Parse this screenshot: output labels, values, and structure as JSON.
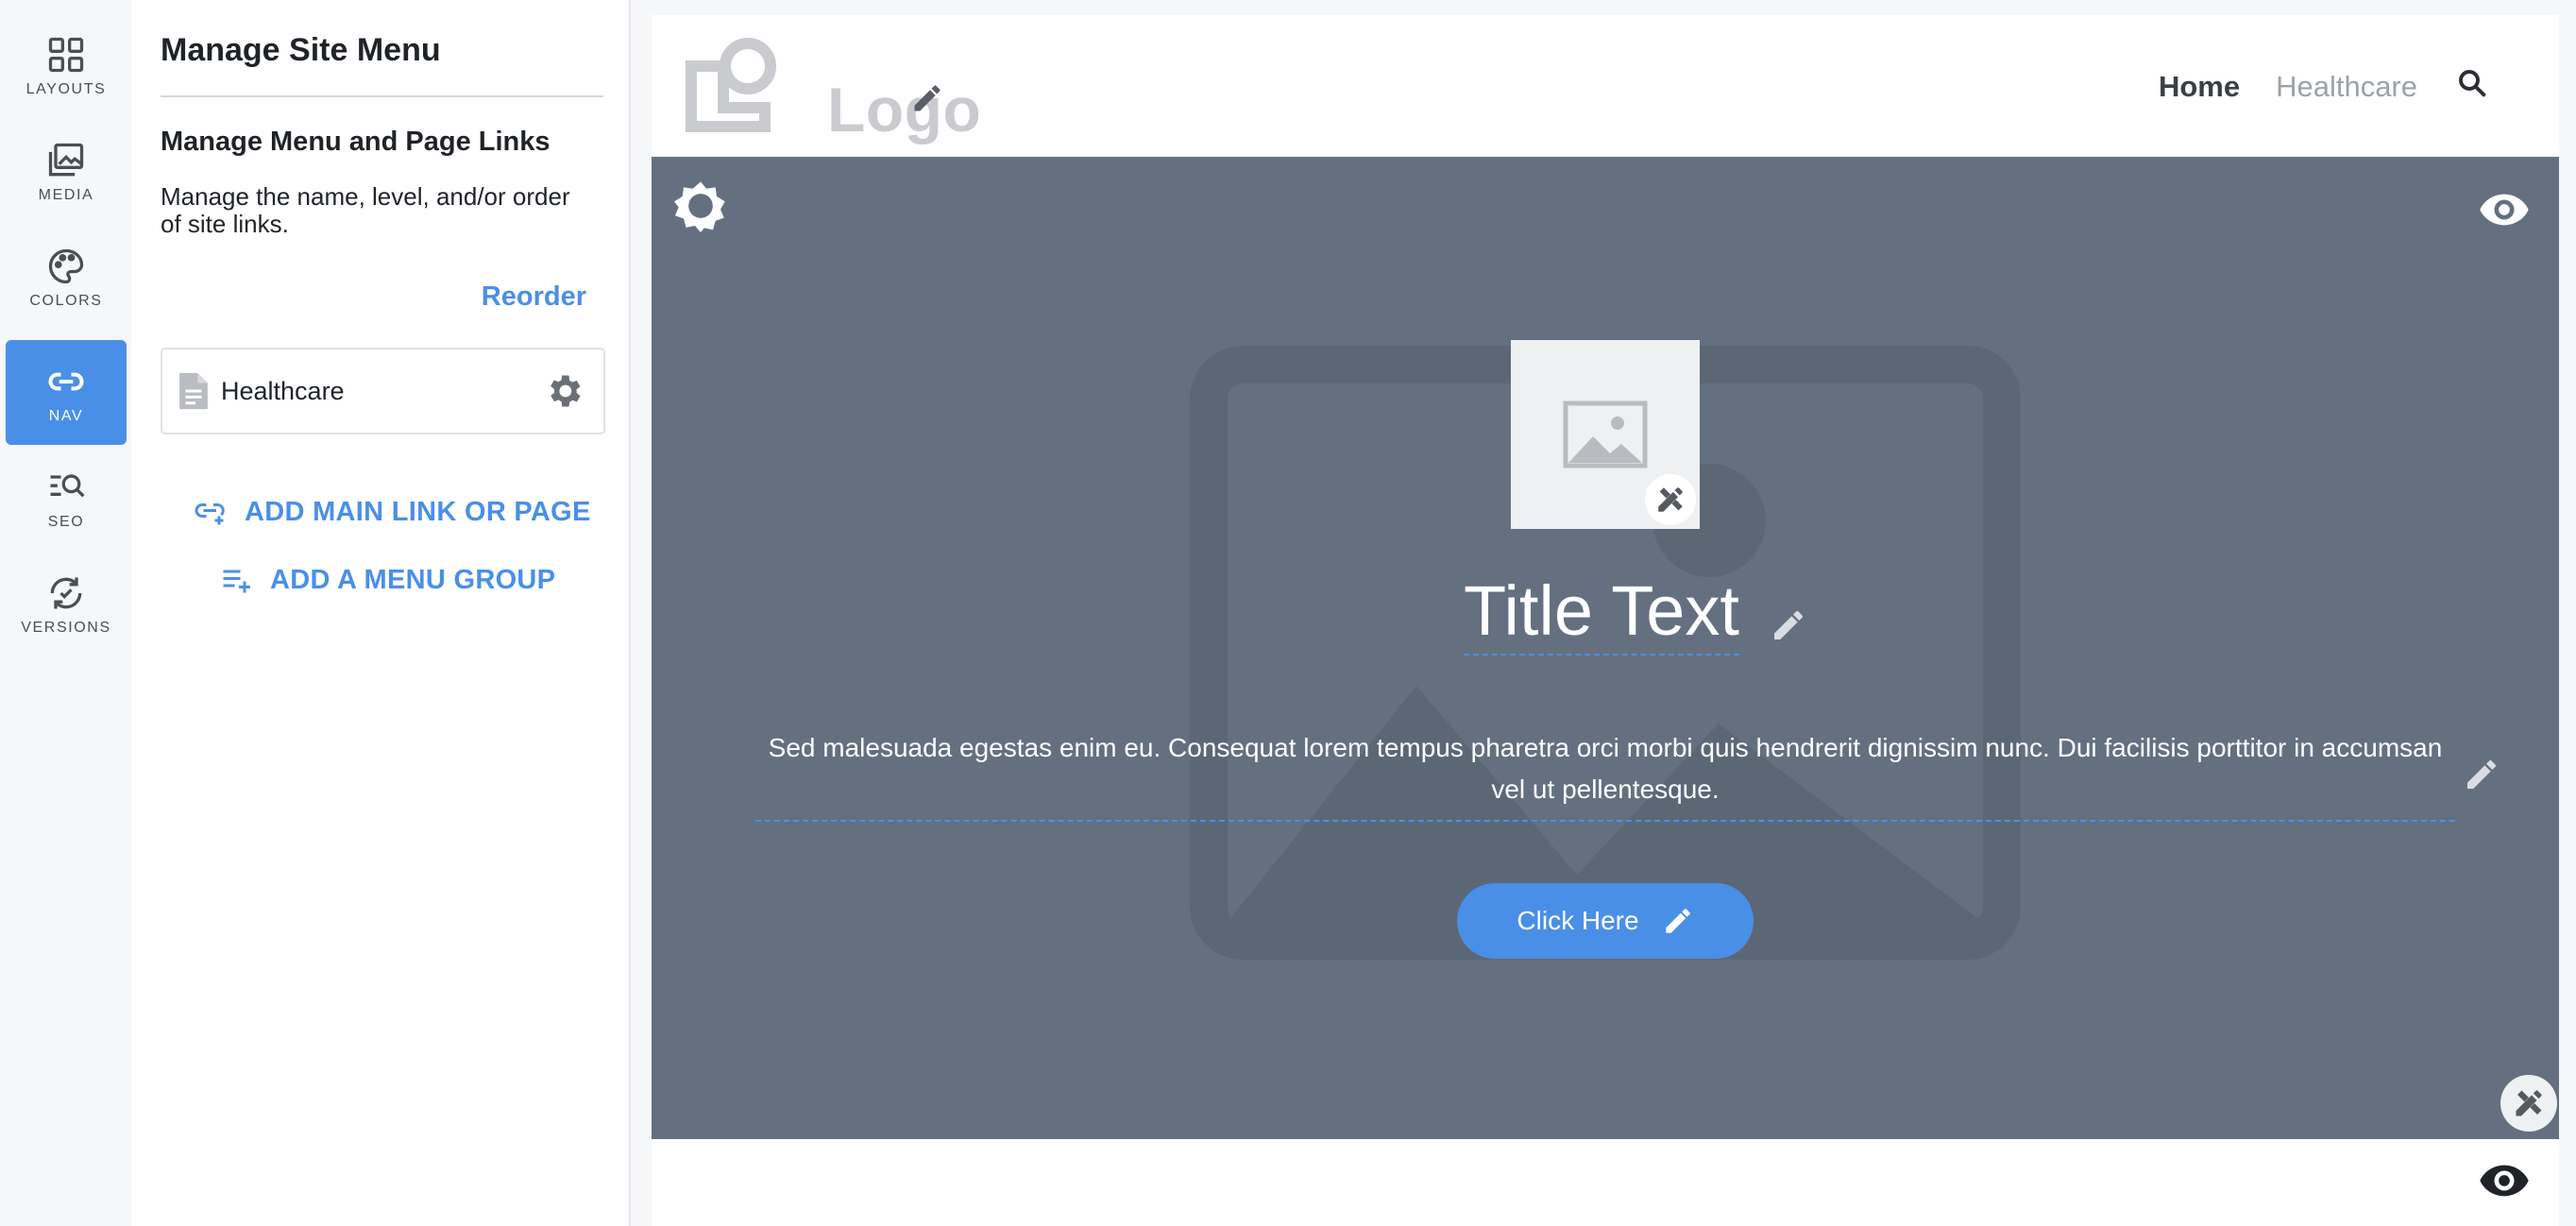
{
  "rail": {
    "items": [
      {
        "label": "LAYOUTS",
        "icon": "layouts-icon"
      },
      {
        "label": "MEDIA",
        "icon": "media-icon"
      },
      {
        "label": "COLORS",
        "icon": "palette-icon"
      },
      {
        "label": "NAV",
        "icon": "link-icon",
        "active": true
      },
      {
        "label": "SEO",
        "icon": "seo-search-icon"
      },
      {
        "label": "VERSIONS",
        "icon": "versions-icon"
      }
    ]
  },
  "panel": {
    "title": "Manage Site Menu",
    "subtitle": "Manage Menu and Page Links",
    "description": "Manage the name, level, and/or order of site links.",
    "reorder_label": "Reorder",
    "links": [
      {
        "name": "Healthcare"
      }
    ],
    "add_main_link_label": "ADD MAIN LINK OR PAGE",
    "add_menu_group_label": "ADD A MENU GROUP"
  },
  "site": {
    "logo_text": "Logo",
    "nav": {
      "home_label": "Home",
      "healthcare_label": "Healthcare"
    },
    "hero": {
      "title": "Title Text",
      "body": "Sed malesuada egestas enim eu. Consequat lorem tempus pharetra orci morbi quis hendrerit dignissim nunc. Dui facilisis porttitor in accumsan vel ut pellentesque.",
      "button_label": "Click Here"
    }
  },
  "colors": {
    "accent": "#4a8fe7",
    "hero_bg": "#64707f",
    "rail_bg": "#f6f7f9"
  }
}
